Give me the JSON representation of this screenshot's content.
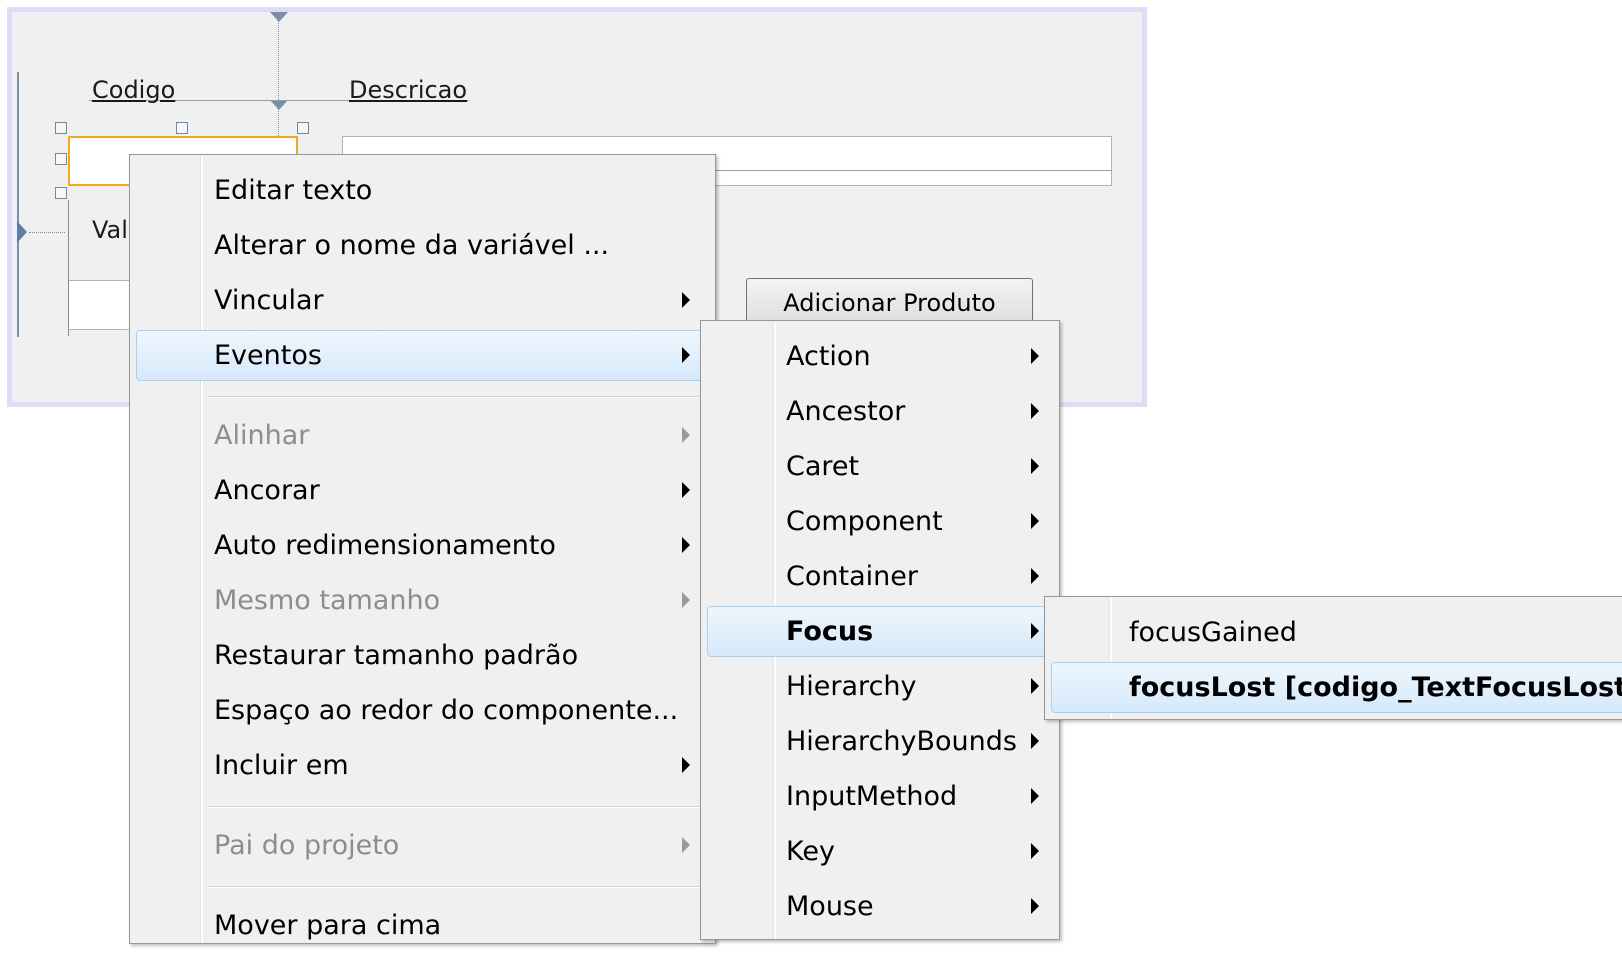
{
  "form": {
    "label_codigo": "Codigo",
    "label_descricao": "Descricao",
    "label_valor": "Val",
    "button_adicionar": "Adicionar Produto"
  },
  "context_menu": {
    "items": [
      {
        "label": "Editar texto",
        "submenu": false,
        "disabled": false
      },
      {
        "label": "Alterar o nome da variável ...",
        "submenu": false,
        "disabled": false
      },
      {
        "label": "Vincular",
        "submenu": true,
        "disabled": false
      },
      {
        "label": "Eventos",
        "submenu": true,
        "disabled": false,
        "highlighted": true
      },
      {
        "label": "Alinhar",
        "submenu": true,
        "disabled": true
      },
      {
        "label": "Ancorar",
        "submenu": true,
        "disabled": false
      },
      {
        "label": "Auto redimensionamento",
        "submenu": true,
        "disabled": false
      },
      {
        "label": "Mesmo tamanho",
        "submenu": true,
        "disabled": true
      },
      {
        "label": "Restaurar tamanho padrão",
        "submenu": false,
        "disabled": false
      },
      {
        "label": "Espaço ao redor do componente...",
        "submenu": false,
        "disabled": false
      },
      {
        "label": "Incluir em",
        "submenu": true,
        "disabled": false
      },
      {
        "label": "Pai do projeto",
        "submenu": true,
        "disabled": true
      },
      {
        "label": "Mover para cima",
        "submenu": false,
        "disabled": false
      }
    ]
  },
  "events_menu": {
    "items": [
      {
        "label": "Action"
      },
      {
        "label": "Ancestor"
      },
      {
        "label": "Caret"
      },
      {
        "label": "Component"
      },
      {
        "label": "Container"
      },
      {
        "label": "Focus",
        "highlighted": true
      },
      {
        "label": "Hierarchy"
      },
      {
        "label": "HierarchyBounds"
      },
      {
        "label": "InputMethod"
      },
      {
        "label": "Key"
      },
      {
        "label": "Mouse"
      }
    ]
  },
  "focus_menu": {
    "items": [
      {
        "label": "focusGained"
      },
      {
        "label": "focusLost [codigo_TextFocusLost]",
        "highlighted": true
      }
    ]
  },
  "icons": {
    "submenu_arrow": "triangle-right-icon",
    "anchor_marker": "anchor-triangle-icon"
  }
}
